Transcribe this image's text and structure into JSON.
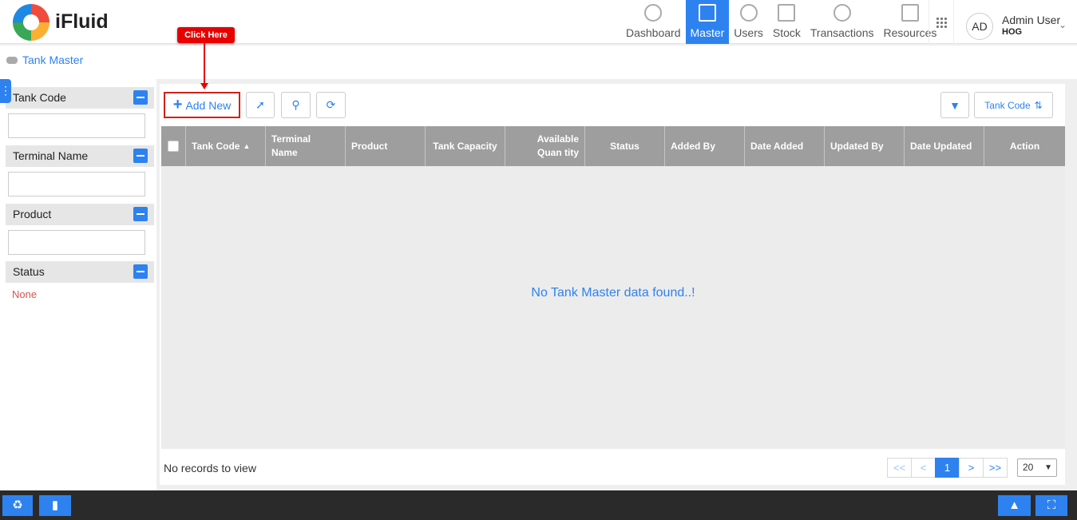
{
  "app": {
    "brand": "iFluid"
  },
  "nav": [
    {
      "label": "Dashboard",
      "icon": "dashboard-icon",
      "active": false
    },
    {
      "label": "Master",
      "icon": "master-icon",
      "active": true
    },
    {
      "label": "Users",
      "icon": "users-icon",
      "active": false
    },
    {
      "label": "Stock",
      "icon": "stock-icon",
      "active": false
    },
    {
      "label": "Transactions",
      "icon": "transactions-icon",
      "active": false
    },
    {
      "label": "Resources",
      "icon": "resources-icon",
      "active": false
    }
  ],
  "user": {
    "initials": "AD",
    "name": "Admin User",
    "role": "HOG"
  },
  "breadcrumb": {
    "label": "Tank Master"
  },
  "callout": {
    "label": "Click Here"
  },
  "filters": [
    {
      "label": "Tank Code",
      "input_value": ""
    },
    {
      "label": "Terminal Name",
      "input_value": ""
    },
    {
      "label": "Product",
      "input_value": ""
    },
    {
      "label": "Status",
      "value": "None"
    }
  ],
  "toolbar": {
    "add_label": "Add New",
    "sort_label": "Tank Code"
  },
  "grid": {
    "columns": [
      "Tank Code",
      "Terminal Name",
      "Product",
      "Tank Capacity",
      "Available Quan tity",
      "Status",
      "Added By",
      "Date Added",
      "Updated By",
      "Date Updated",
      "Action"
    ],
    "empty_message": "No Tank Master data found..!",
    "footer_text": "No records to view"
  },
  "pagination": {
    "first": "<<",
    "prev": "<",
    "current": "1",
    "next": ">",
    "last": ">>",
    "page_size": "20"
  },
  "colors": {
    "accent": "#2d82f0",
    "callout": "#e60000",
    "header_bg": "#9e9e9e"
  }
}
